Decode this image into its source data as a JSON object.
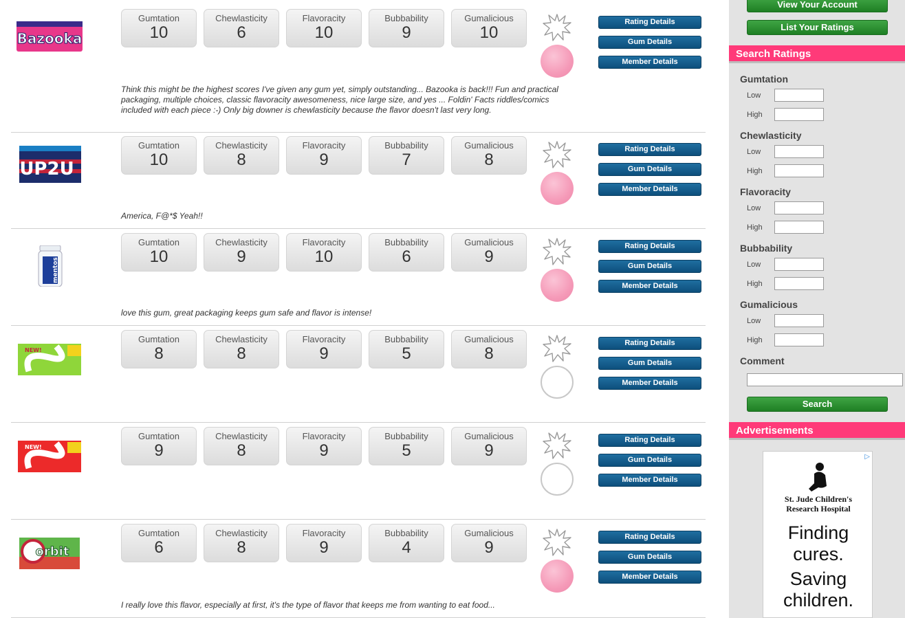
{
  "rows": [
    {
      "image": "bazooka-gum-pack",
      "gumtation": "10",
      "chewlasticity": "6",
      "flavoracity": "10",
      "bubbability": "9",
      "gumalicious": "10",
      "bubble": "pink",
      "comment": "Think this might be the highest scores I've given any gum yet, simply outstanding... Bazooka is back!!! Fun and practical packaging, multiple choices, classic flavoracity awesomeness, nice large size, and yes ... Foldin' Facts riddles/comics included with each piece :-) Only big downer is chewlasticity because the flavor doesn't last very long."
    },
    {
      "image": "mentos-up2u-gum-pack",
      "gumtation": "10",
      "chewlasticity": "8",
      "flavoracity": "9",
      "bubbability": "7",
      "gumalicious": "8",
      "bubble": "pink",
      "comment": "America, F@*$ Yeah!!"
    },
    {
      "image": "mentos-pure-gum-bottle",
      "gumtation": "10",
      "chewlasticity": "9",
      "flavoracity": "10",
      "bubbability": "6",
      "gumalicious": "9",
      "bubble": "pink",
      "comment": "love this gum, great packaging keeps gum safe and flavor is intense!"
    },
    {
      "image": "stride-sour-patch-green-pack",
      "gumtation": "8",
      "chewlasticity": "8",
      "flavoracity": "9",
      "bubbability": "5",
      "gumalicious": "8",
      "bubble": "empty",
      "comment": ""
    },
    {
      "image": "stride-sour-patch-red-pack",
      "gumtation": "9",
      "chewlasticity": "8",
      "flavoracity": "9",
      "bubbability": "5",
      "gumalicious": "9",
      "bubble": "empty",
      "comment": ""
    },
    {
      "image": "orbit-gum-pack",
      "gumtation": "6",
      "chewlasticity": "8",
      "flavoracity": "9",
      "bubbability": "4",
      "gumalicious": "9",
      "bubble": "pink",
      "comment": "I really love this flavor, especially at first, it's the type of flavor that keeps me from wanting to eat food..."
    }
  ],
  "labels": {
    "gumtation": "Gumtation",
    "chewlasticity": "Chewlasticity",
    "flavoracity": "Flavoracity",
    "bubbability": "Bubbability",
    "gumalicious": "Gumalicious",
    "rating_details": "Rating Details",
    "gum_details": "Gum Details",
    "member_details": "Member Details"
  },
  "sidebar": {
    "view_account": "View Your Account",
    "list_ratings": "List Your Ratings",
    "search_title": "Search Ratings",
    "criteria": [
      "Gumtation",
      "Chewlasticity",
      "Flavoracity",
      "Bubbability",
      "Gumalicious"
    ],
    "low": "Low",
    "high": "High",
    "comment_label": "Comment",
    "search_button": "Search",
    "ads_title": "Advertisements"
  },
  "ad": {
    "org_line1": "St. Jude Children's",
    "org_line2": "Research Hospital",
    "line1": "Finding",
    "line2": "cures.",
    "line3": "Saving",
    "line4": "children.",
    "ad_choices": "▷"
  },
  "colors": {
    "accent_pink": "#ff3a79",
    "button_blue": "#0d4f7c",
    "button_green": "#1f7f24",
    "bubble_pink": "#f59ab8"
  }
}
